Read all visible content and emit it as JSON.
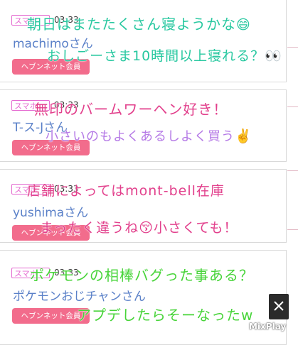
{
  "posts": [
    {
      "platform": "スマホ",
      "time": "03:33",
      "username": "machimoさん",
      "member_badge": "ヘブンネット会員",
      "handwritten": [
        "朝日はまたたくさん寝ようかな",
        "おしごーさま10時間以上寝れる？"
      ],
      "emoji": [
        "😄",
        "👀"
      ]
    },
    {
      "platform": "スマホ",
      "time": "03:33",
      "username": "T-ス-Jさん",
      "member_badge": "ヘブンネット会員",
      "handwritten": [
        "無印のバームワーヘン好き！",
        "小さいのもよくあるしよく買う"
      ],
      "emoji": [
        "✌️"
      ]
    },
    {
      "platform": "スマホ",
      "time": "03:33",
      "username": "yushimaさん",
      "member_badge": "ヘブンネット会員",
      "handwritten": [
        "店舗によってはmont-bell在庫",
        "まったく違うね",
        "小さくても！"
      ],
      "emoji": [
        "😚"
      ]
    },
    {
      "platform": "スマホ",
      "time": "03:33",
      "username": "ポケモンおじチャンさん",
      "member_badge": "ヘブンネット会員",
      "handwritten": [
        "ポケモンの相棒バグった事ある？",
        "アプデしたらそーなったw"
      ]
    }
  ],
  "watermark": "MixPlay",
  "colors": {
    "member_button": "#f26c8c",
    "platform_tag": "#e46ad0",
    "username": "#5a80c8",
    "ink_green": "#28c8a0",
    "ink_pink": "#e2408c",
    "ink_purple": "#b57ae6",
    "ink_lime": "#48d43a"
  },
  "icons": [
    "close-icon"
  ]
}
